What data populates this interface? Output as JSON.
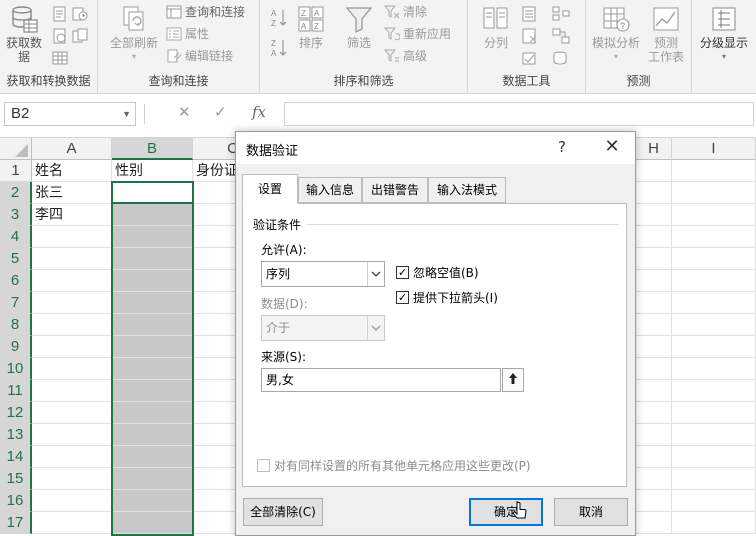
{
  "ribbon": {
    "groups": {
      "get_transform": {
        "label": "获取和转换数据",
        "get_data_line1": "获取数",
        "get_data_line2": "据"
      },
      "queries": {
        "label": "查询和连接",
        "refresh_all": "全部刷新",
        "queries_connections": "查询和连接",
        "properties": "属性",
        "edit_links": "编辑链接"
      },
      "sort_filter": {
        "label": "排序和筛选",
        "sort": "排序",
        "filter": "筛选",
        "clear": "清除",
        "reapply": "重新应用",
        "advanced": "高级"
      },
      "data_tools": {
        "label": "数据工具",
        "text_to_columns": "分列"
      },
      "forecast": {
        "label": "预测",
        "what_if": "模拟分析",
        "forecast_sheet_line1": "预测",
        "forecast_sheet_line2": "工作表"
      },
      "outline": {
        "outline": "分级显示"
      }
    }
  },
  "formula_bar": {
    "name_box": "B2",
    "fx": "fx",
    "value": ""
  },
  "sheet": {
    "columns": [
      "A",
      "B",
      "C",
      "H",
      "I"
    ],
    "rows": [
      "1",
      "2",
      "3",
      "4",
      "5",
      "6",
      "7",
      "8",
      "9",
      "10",
      "11",
      "12",
      "13",
      "14",
      "15",
      "16",
      "17"
    ],
    "cells": {
      "A1": "姓名",
      "B1": "性别",
      "C1": "身份证",
      "A2": "张三",
      "A3": "李四"
    }
  },
  "dialog": {
    "title": "数据验证",
    "help": "?",
    "close": "✕",
    "tabs": [
      "设置",
      "输入信息",
      "出错警告",
      "输入法模式"
    ],
    "active_tab": "设置",
    "section_title": "验证条件",
    "allow_label": "允许(A):",
    "allow_value": "序列",
    "data_label": "数据(D):",
    "data_value": "介于",
    "ignore_blank": {
      "label": "忽略空值(B)",
      "checked": true
    },
    "in_cell_dropdown": {
      "label": "提供下拉箭头(I)",
      "checked": true
    },
    "source_label": "来源(S):",
    "source_value": "男,女",
    "apply_all": {
      "label": "对有同样设置的所有其他单元格应用这些更改(P)",
      "checked": false
    },
    "buttons": {
      "clear_all": "全部清除(C)",
      "ok": "确定",
      "cancel": "取消"
    }
  }
}
